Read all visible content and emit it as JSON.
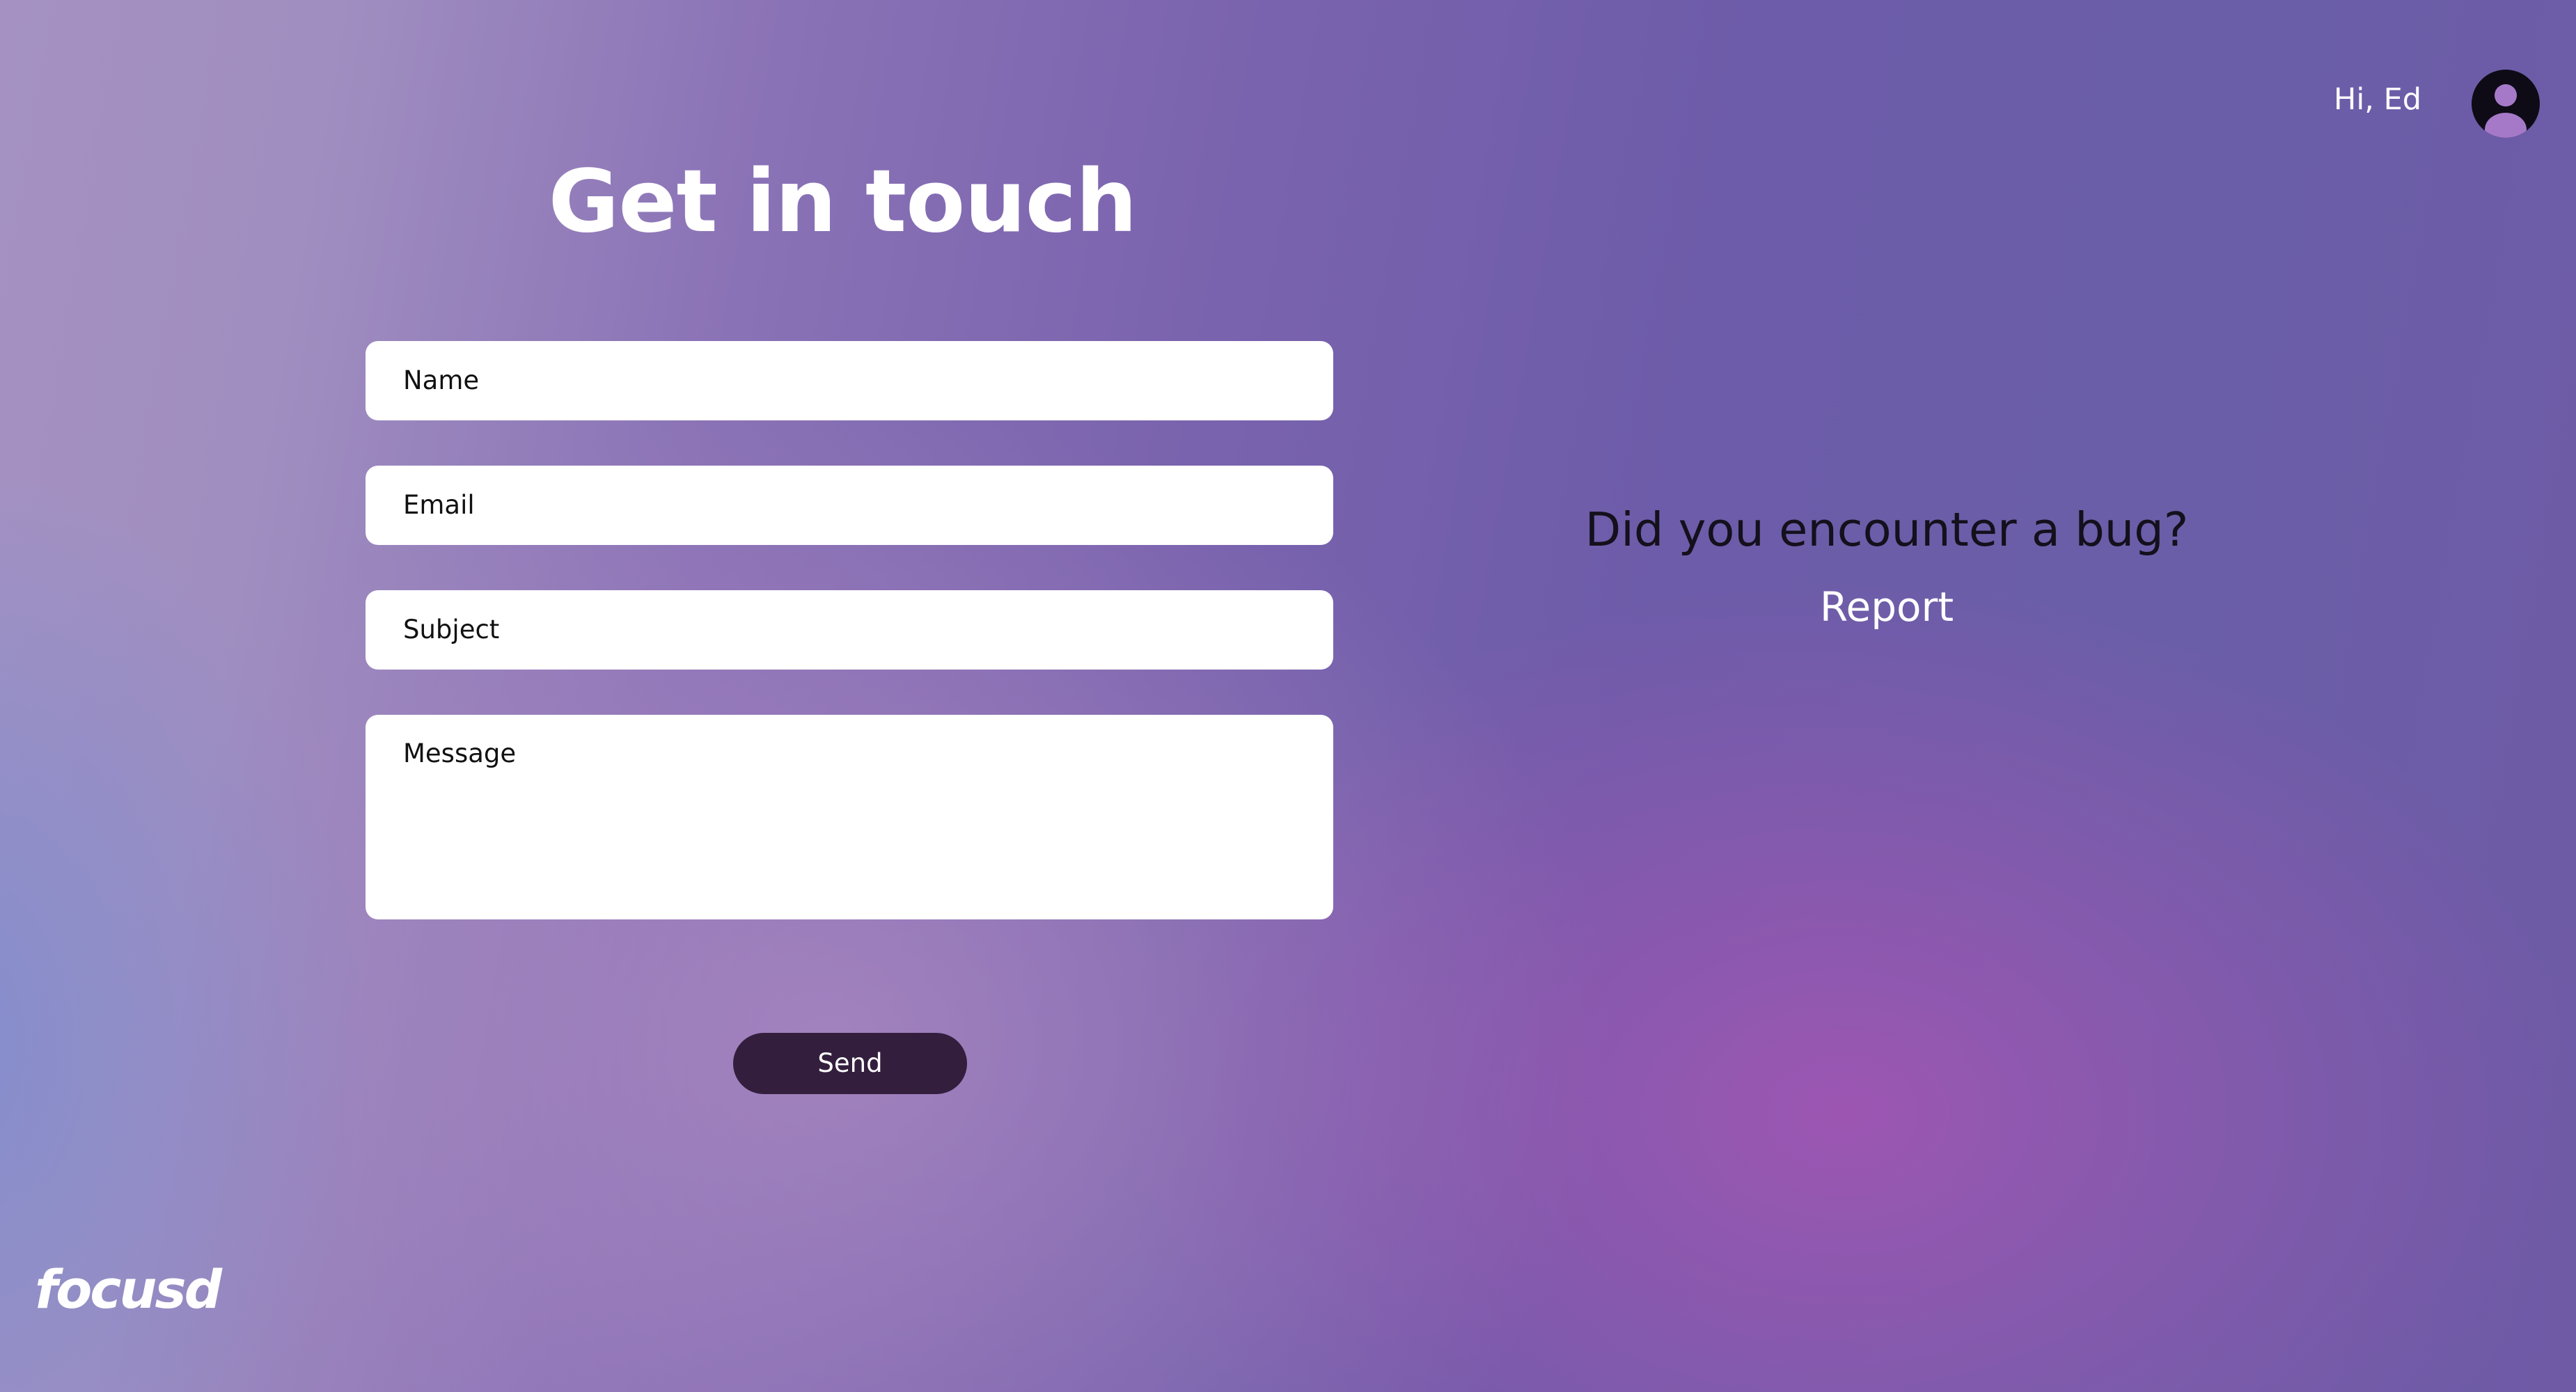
{
  "header": {
    "greeting": "Hi, Ed",
    "avatar_icon": "user-avatar-icon"
  },
  "page": {
    "title": "Get in touch"
  },
  "form": {
    "name_placeholder": "Name",
    "email_placeholder": "Email",
    "subject_placeholder": "Subject",
    "message_placeholder": "Message",
    "send_label": "Send"
  },
  "bug_report": {
    "question": "Did you encounter a bug?",
    "link_label": "Report"
  },
  "brand": {
    "logo_text": "focusd"
  },
  "colors": {
    "button_bg": "#331f3d",
    "background_start": "#a592c2",
    "background_end": "#6a5ea8",
    "accent_magenta": "#a555b4"
  }
}
